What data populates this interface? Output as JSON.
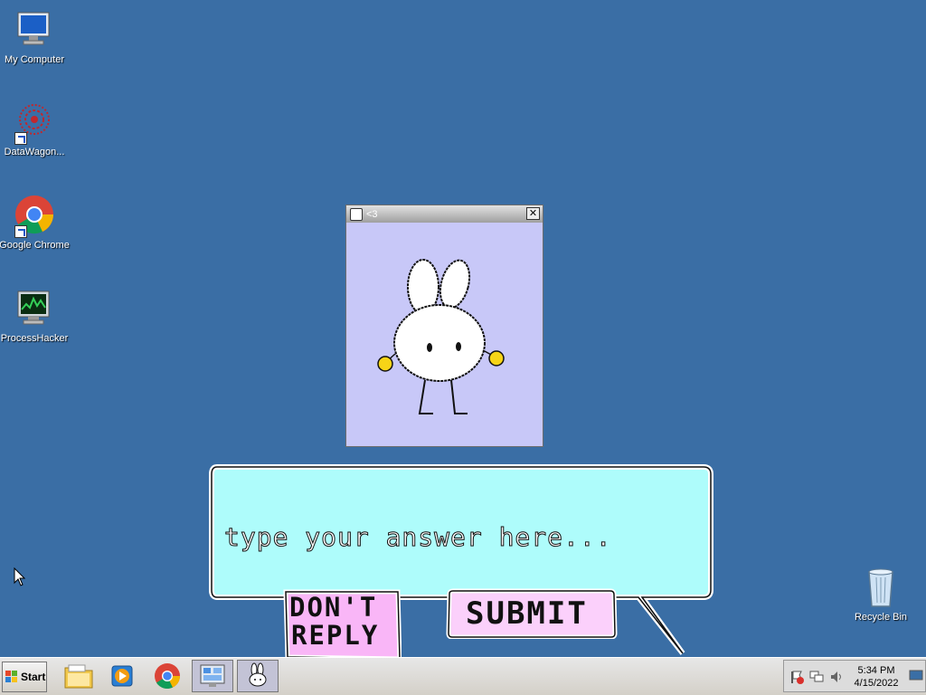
{
  "desktop": {
    "icons": [
      {
        "label": "My Computer",
        "icon": "computer-icon"
      },
      {
        "label": "DataWagon...",
        "icon": "datawagon-icon"
      },
      {
        "label": "Google Chrome",
        "icon": "chrome-icon"
      },
      {
        "label": "ProcessHacker",
        "icon": "process-hacker-icon"
      },
      {
        "label": "Recycle Bin",
        "icon": "recycle-bin-icon"
      }
    ]
  },
  "window": {
    "title": "<3",
    "close_glyph": "✕"
  },
  "prompt": {
    "placeholder": "type your answer here...",
    "dont_reply_line1": "DON'T",
    "dont_reply_line2": "REPLY",
    "submit_label": "SUBMIT"
  },
  "taskbar": {
    "start_label": "Start",
    "apps": [
      "file-explorer-icon",
      "media-player-icon",
      "chrome-icon",
      "control-panel-icon",
      "bunny-app-icon"
    ],
    "time": "5:34 PM",
    "date": "4/15/2022"
  },
  "colors": {
    "desktop": "#3a6ea5",
    "bubble": "#aefcfb",
    "button": "#f9b6f7",
    "window_bg": "#c8c8f8"
  }
}
